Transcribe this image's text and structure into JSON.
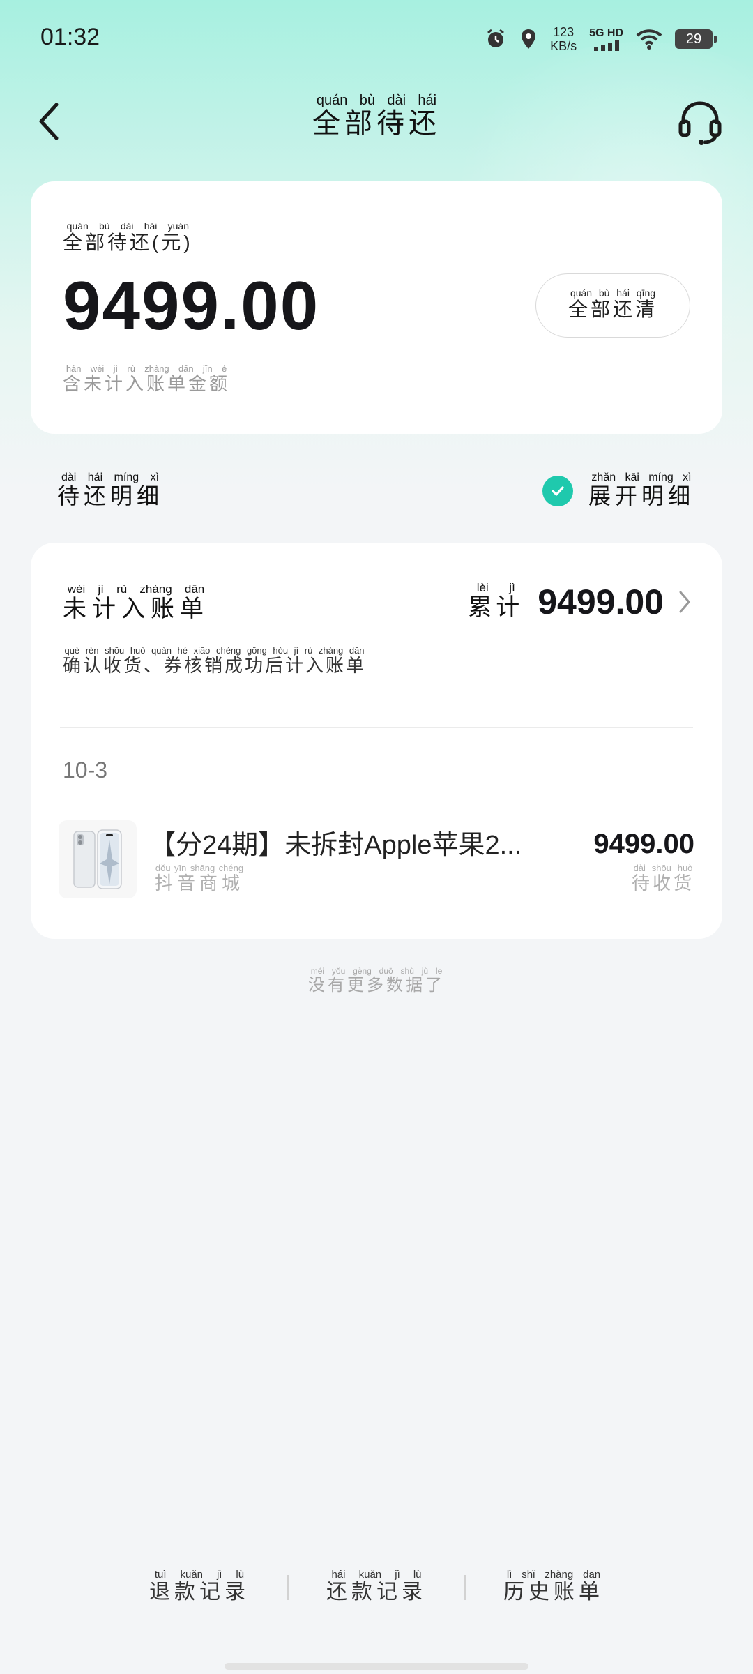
{
  "status_bar": {
    "time": "01:32",
    "speed_value": "123",
    "speed_unit": "KB/s",
    "network": "5G HD",
    "battery": "29"
  },
  "nav": {
    "title": "全部待还",
    "title_pinyin": "quán bù dài hái"
  },
  "summary": {
    "label": "全部待还(元)",
    "label_pinyin": "quán bù dài hái  yuán",
    "amount": "9499.00",
    "note": "含未计入账单金额",
    "note_pinyin": "hán wèi jì rù zhàng dān jīn é",
    "pay_all_button": "全部还清",
    "pay_all_pinyin": "quán bù hái qīng"
  },
  "details_header": {
    "title": "待还明细",
    "title_pinyin": "dài hái míng xì",
    "expand_label": "展开明细",
    "expand_pinyin": "zhǎn kāi míng xì",
    "expanded": true
  },
  "unbilled": {
    "title": "未计入账单",
    "title_pinyin": "wèi jì rù zhàng dān",
    "total_label": "累计",
    "total_pinyin": "lèi jì",
    "total_value": "9499.00",
    "description": "确认收货、券核销成功后计入账单",
    "description_pinyin": "què rèn shōu huò  quàn hé xiāo chéng gōng hòu jì rù zhàng dān",
    "date": "10-3",
    "items": [
      {
        "name": "【分24期】未拆封Apple苹果2...",
        "store": "抖音商城",
        "store_pinyin": "dǒu yīn shāng chéng",
        "price": "9499.00",
        "status": "待收货",
        "status_pinyin": "dài shōu huò",
        "image_icon": "phone-product-icon"
      }
    ]
  },
  "footer_note": "没有更多数据了",
  "footer_note_pinyin": "méi yǒu gèng duō shù jù le",
  "bottom_links": [
    {
      "label": "退款记录",
      "pinyin": "tuì kuǎn jì lù"
    },
    {
      "label": "还款记录",
      "pinyin": "hái kuǎn jì lù"
    },
    {
      "label": "历史账单",
      "pinyin": "lì shǐ zhàng dān"
    }
  ],
  "colors": {
    "accent": "#1fc9ad",
    "header_gradient_top": "#a7f0e0"
  }
}
